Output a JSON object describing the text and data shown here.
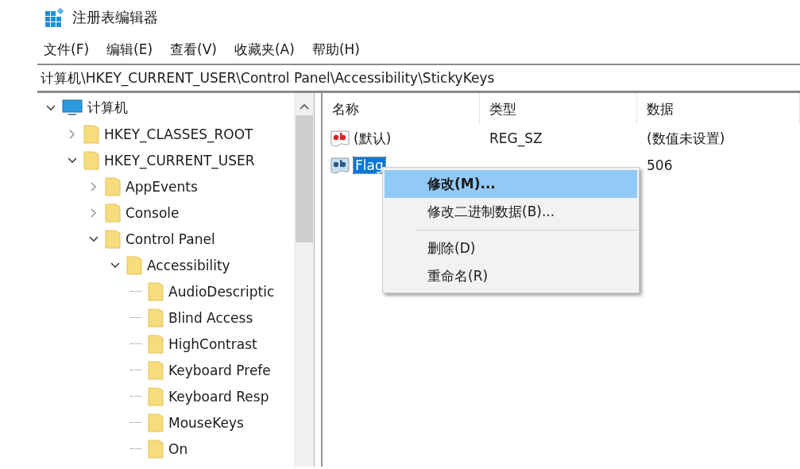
{
  "window": {
    "title": "注册表编辑器"
  },
  "menu_bar": [
    "文件(F)",
    "编辑(E)",
    "查看(V)",
    "收藏夹(A)",
    "帮助(H)"
  ],
  "address_bar": {
    "value": "计算机\\HKEY_CURRENT_USER\\Control Panel\\Accessibility\\StickyKeys"
  },
  "tree": {
    "items": [
      {
        "label": "计算机",
        "kind": "computer",
        "expanded": true,
        "children": [
          {
            "label": "HKEY_CLASSES_ROOT",
            "kind": "folder",
            "expanded": false
          },
          {
            "label": "HKEY_CURRENT_USER",
            "kind": "folder",
            "expanded": true,
            "children": [
              {
                "label": "AppEvents",
                "kind": "folder",
                "expanded": false
              },
              {
                "label": "Console",
                "kind": "folder",
                "expanded": false
              },
              {
                "label": "Control Panel",
                "kind": "folder",
                "expanded": true,
                "children": [
                  {
                    "label": "Accessibility",
                    "kind": "folder",
                    "expanded": true,
                    "children": [
                      {
                        "label": "AudioDescriptic",
                        "kind": "folder"
                      },
                      {
                        "label": "Blind Access",
                        "kind": "folder"
                      },
                      {
                        "label": "HighContrast",
                        "kind": "folder"
                      },
                      {
                        "label": "Keyboard Prefe",
                        "kind": "folder"
                      },
                      {
                        "label": "Keyboard Resp",
                        "kind": "folder"
                      },
                      {
                        "label": "MouseKeys",
                        "kind": "folder"
                      },
                      {
                        "label": "On",
                        "kind": "folder"
                      }
                    ]
                  }
                ]
              }
            ]
          }
        ]
      }
    ]
  },
  "values_list": {
    "columns": [
      "名称",
      "类型",
      "数据"
    ],
    "rows": [
      {
        "name": "(默认)",
        "type": "REG_SZ",
        "data": "(数值未设置)",
        "selected": false
      },
      {
        "name": "Flag",
        "data": "506",
        "selected": true
      }
    ]
  },
  "context_menu": {
    "items": [
      {
        "kind": "item",
        "label": "修改(M)...",
        "default": true,
        "selected": true
      },
      {
        "kind": "item",
        "label": "修改二进制数据(B)...",
        "default": false,
        "selected": false
      },
      {
        "kind": "separator"
      },
      {
        "kind": "item",
        "label": "删除(D)",
        "default": false,
        "selected": false
      },
      {
        "kind": "item",
        "label": "重命名(R)",
        "default": false,
        "selected": false
      }
    ]
  }
}
